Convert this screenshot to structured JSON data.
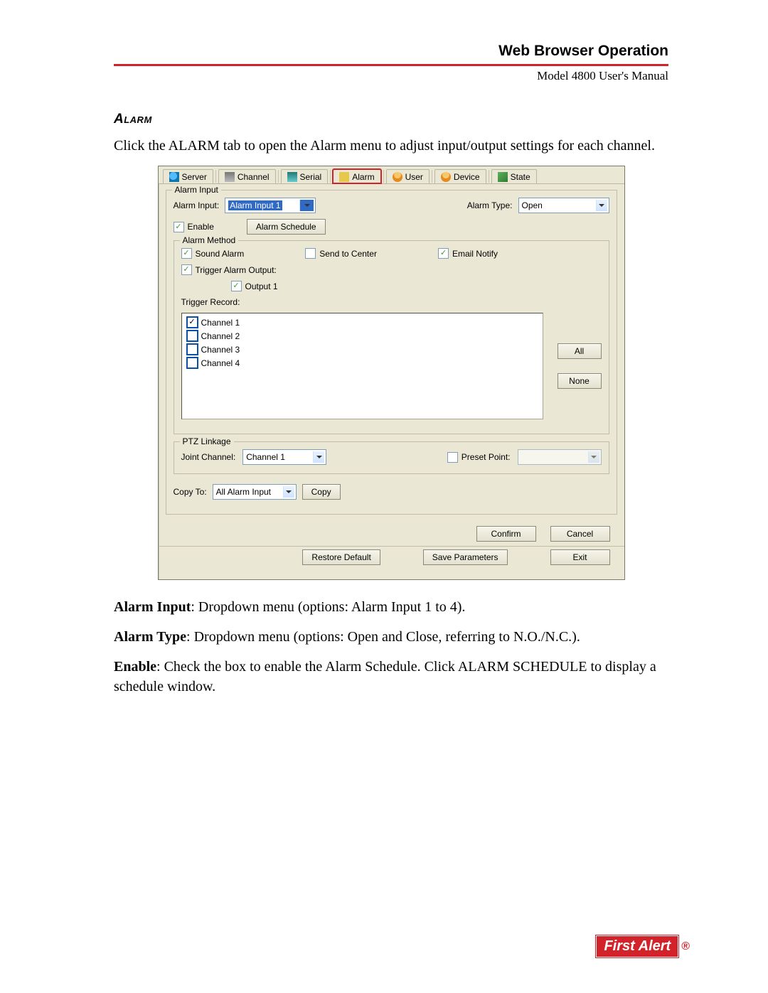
{
  "header": {
    "title": "Web Browser Operation",
    "manual": "Model 4800 User's Manual"
  },
  "section": {
    "heading": "Alarm",
    "intro": "Click the ALARM tab to open the Alarm menu to adjust input/output settings for each channel."
  },
  "tabs": [
    {
      "label": "Server",
      "icon": "ic-srv"
    },
    {
      "label": "Channel",
      "icon": "ic-ch"
    },
    {
      "label": "Serial",
      "icon": "ic-ser"
    },
    {
      "label": "Alarm",
      "icon": "ic-al",
      "active": true
    },
    {
      "label": "User",
      "icon": "ic-us"
    },
    {
      "label": "Device",
      "icon": "ic-dv"
    },
    {
      "label": "State",
      "icon": "ic-st"
    }
  ],
  "alarm_input": {
    "group_title": "Alarm Input",
    "input_label": "Alarm Input:",
    "input_value": "Alarm Input 1",
    "type_label": "Alarm Type:",
    "type_value": "Open",
    "enable_label": "Enable",
    "schedule_btn": "Alarm Schedule"
  },
  "method": {
    "group_title": "Alarm Method",
    "sound": "Sound Alarm",
    "send": "Send to Center",
    "email": "Email Notify",
    "trigger_out": "Trigger Alarm Output:",
    "output1": "Output 1",
    "trigger_rec": "Trigger Record:",
    "channels": [
      "Channel 1",
      "Channel 2",
      "Channel 3",
      "Channel 4"
    ],
    "all_btn": "All",
    "none_btn": "None"
  },
  "ptz": {
    "group_title": "PTZ Linkage",
    "joint_label": "Joint Channel:",
    "joint_value": "Channel 1",
    "preset_label": "Preset Point:",
    "preset_value": ""
  },
  "copy": {
    "label": "Copy To:",
    "value": "All Alarm Input",
    "btn": "Copy"
  },
  "buttons": {
    "confirm": "Confirm",
    "cancel": "Cancel",
    "restore": "Restore Default",
    "save": "Save Parameters",
    "exit": "Exit"
  },
  "descriptions": [
    {
      "bold": "Alarm Input",
      "text": ": Dropdown menu (options: Alarm Input 1 to 4)."
    },
    {
      "bold": "Alarm Type",
      "text": ": Dropdown menu (options: Open and Close, referring to N.O./N.C.)."
    },
    {
      "bold": "Enable",
      "text": ": Check the box to enable the Alarm Schedule. Click ALARM SCHEDULE to display a schedule window."
    }
  ],
  "brand": {
    "name": "First Alert",
    "reg": "®"
  }
}
